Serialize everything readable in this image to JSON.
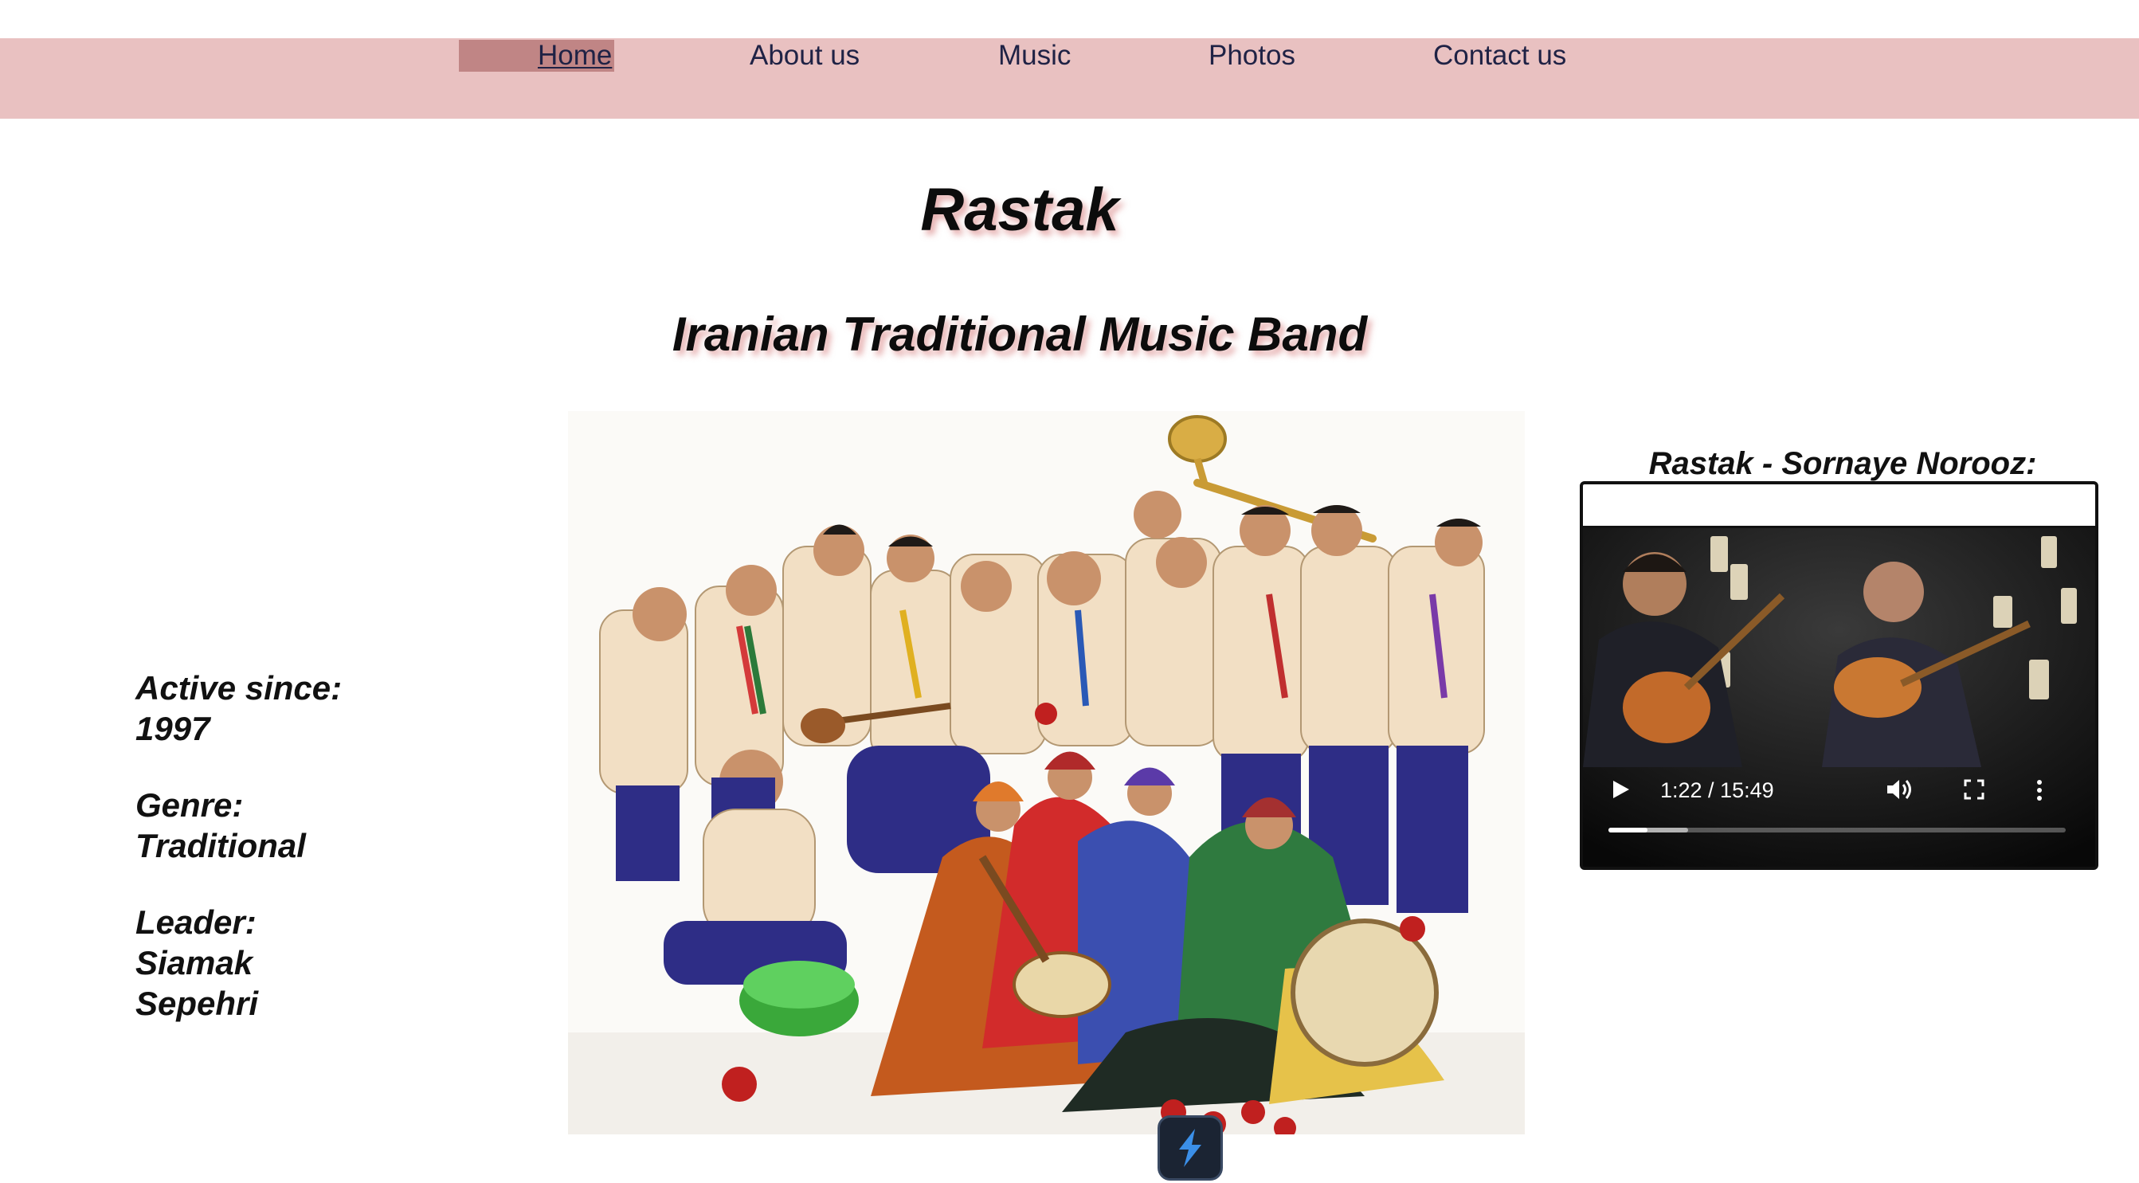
{
  "nav": {
    "items": [
      {
        "label": "Home",
        "active": true
      },
      {
        "label": "About us"
      },
      {
        "label": "Music"
      },
      {
        "label": "Photos"
      },
      {
        "label": "Contact us"
      }
    ],
    "active_bg_color": "#c08585",
    "bar_color": "#e9c1c1"
  },
  "header": {
    "title": "Rastak",
    "subtitle": "Iranian Traditional Music Band"
  },
  "info": {
    "active": "Active since: 1997",
    "genre": "Genre: Traditional",
    "leader": "Leader: Siamak Sepehri"
  },
  "band_photo": {
    "icon": "band-group-photo"
  },
  "video": {
    "caption": "Rastak - Sornaye Norooz:",
    "time": "1:22 / 15:49",
    "progress_fraction": 0.086,
    "buffered_fraction": 0.175
  },
  "taskbar": {
    "app_icon": "app-launcher-icon",
    "accent": "#3b8fe8"
  }
}
